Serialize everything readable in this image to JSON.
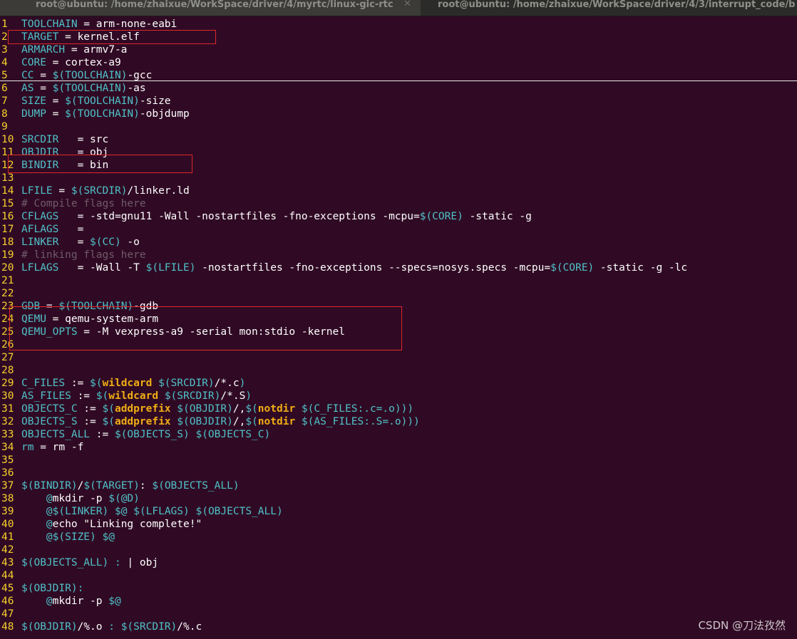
{
  "tabs": [
    {
      "title": "root@ubuntu: /home/zhaixue/WorkSpace/driver/4/myrtc/linux-gic-rtc",
      "close": "✕"
    },
    {
      "title": "root@ubuntu: /home/zhaixue/WorkSpace/driver/4/3/interrupt_code/b"
    }
  ],
  "watermark": "CSDN @刀法孜然",
  "lines": [
    {
      "n": "1",
      "segs": [
        [
          "v",
          "TOOLCHAIN"
        ],
        [
          "t",
          " = arm-none-eabi"
        ]
      ]
    },
    {
      "n": "2",
      "segs": [
        [
          "v",
          "TARGET"
        ],
        [
          "t",
          " = kernel.elf"
        ]
      ]
    },
    {
      "n": "3",
      "segs": [
        [
          "v",
          "ARMARCH"
        ],
        [
          "t",
          " = armv7-a"
        ]
      ]
    },
    {
      "n": "4",
      "segs": [
        [
          "v",
          "CORE"
        ],
        [
          "t",
          " = cortex-a9"
        ]
      ]
    },
    {
      "n": "5",
      "segs": [
        [
          "v",
          "CC"
        ],
        [
          "t",
          " = "
        ],
        [
          "v",
          "$(TOOLCHAIN)"
        ],
        [
          "t",
          "-gcc"
        ]
      ]
    },
    {
      "n": "6",
      "segs": [
        [
          "v",
          "AS"
        ],
        [
          "t",
          " = "
        ],
        [
          "v",
          "$(TOOLCHAIN)"
        ],
        [
          "t",
          "-as"
        ]
      ]
    },
    {
      "n": "7",
      "segs": [
        [
          "v",
          "SIZE"
        ],
        [
          "t",
          " = "
        ],
        [
          "v",
          "$(TOOLCHAIN)"
        ],
        [
          "t",
          "-size"
        ]
      ]
    },
    {
      "n": "8",
      "segs": [
        [
          "v",
          "DUMP"
        ],
        [
          "t",
          " = "
        ],
        [
          "v",
          "$(TOOLCHAIN)"
        ],
        [
          "t",
          "-objdump"
        ]
      ]
    },
    {
      "n": "9",
      "segs": []
    },
    {
      "n": "10",
      "segs": [
        [
          "v",
          "SRCDIR"
        ],
        [
          "t",
          "   = src"
        ]
      ]
    },
    {
      "n": "11",
      "segs": [
        [
          "v",
          "OBJDIR"
        ],
        [
          "t",
          "   = obj"
        ]
      ]
    },
    {
      "n": "12",
      "segs": [
        [
          "v",
          "BINDIR"
        ],
        [
          "t",
          "   = bin"
        ]
      ]
    },
    {
      "n": "13",
      "segs": []
    },
    {
      "n": "14",
      "segs": [
        [
          "v",
          "LFILE"
        ],
        [
          "t",
          " = "
        ],
        [
          "v",
          "$(SRCDIR)"
        ],
        [
          "t",
          "/linker.ld"
        ]
      ]
    },
    {
      "n": "15",
      "segs": [
        [
          "c",
          "# Compile flags here"
        ]
      ]
    },
    {
      "n": "16",
      "segs": [
        [
          "v",
          "CFLAGS"
        ],
        [
          "t",
          "   = -std=gnu11 -Wall -nostartfiles -fno-exceptions -mcpu="
        ],
        [
          "v",
          "$(CORE)"
        ],
        [
          "t",
          " -static -g"
        ]
      ]
    },
    {
      "n": "17",
      "segs": [
        [
          "v",
          "AFLAGS"
        ],
        [
          "t",
          "   ="
        ]
      ]
    },
    {
      "n": "18",
      "segs": [
        [
          "v",
          "LINKER"
        ],
        [
          "t",
          "   = "
        ],
        [
          "v",
          "$(CC)"
        ],
        [
          "t",
          " -o"
        ]
      ]
    },
    {
      "n": "19",
      "segs": [
        [
          "c",
          "# linking flags here"
        ]
      ]
    },
    {
      "n": "20",
      "segs": [
        [
          "v",
          "LFLAGS"
        ],
        [
          "t",
          "   = -Wall -T "
        ],
        [
          "v",
          "$(LFILE)"
        ],
        [
          "t",
          " -nostartfiles -fno-exceptions --specs=nosys.specs -mcpu="
        ],
        [
          "v",
          "$(CORE)"
        ],
        [
          "t",
          " -static -g -lc"
        ]
      ]
    },
    {
      "n": "21",
      "segs": []
    },
    {
      "n": "22",
      "segs": []
    },
    {
      "n": "23",
      "segs": [
        [
          "v",
          "GDB"
        ],
        [
          "t",
          " = "
        ],
        [
          "v",
          "$(TOOLCHAIN)"
        ],
        [
          "t",
          "-gdb"
        ]
      ]
    },
    {
      "n": "24",
      "segs": [
        [
          "v",
          "QEMU"
        ],
        [
          "t",
          " = qemu-system-arm"
        ]
      ]
    },
    {
      "n": "25",
      "segs": [
        [
          "v",
          "QEMU_OPTS"
        ],
        [
          "t",
          " = -M vexpress-a9 -serial mon:stdio -kernel"
        ]
      ]
    },
    {
      "n": "26",
      "segs": []
    },
    {
      "n": "27",
      "segs": []
    },
    {
      "n": "28",
      "segs": []
    },
    {
      "n": "29",
      "segs": [
        [
          "v",
          "C_FILES"
        ],
        [
          "t",
          " := "
        ],
        [
          "v",
          "$("
        ],
        [
          "k",
          "wildcard"
        ],
        [
          "t",
          " "
        ],
        [
          "v",
          "$(SRCDIR)"
        ],
        [
          "t",
          "/*.c"
        ],
        [
          "v",
          ")"
        ]
      ]
    },
    {
      "n": "30",
      "segs": [
        [
          "v",
          "AS_FILES"
        ],
        [
          "t",
          " := "
        ],
        [
          "v",
          "$("
        ],
        [
          "k",
          "wildcard"
        ],
        [
          "t",
          " "
        ],
        [
          "v",
          "$(SRCDIR)"
        ],
        [
          "t",
          "/*.S"
        ],
        [
          "v",
          ")"
        ]
      ]
    },
    {
      "n": "31",
      "segs": [
        [
          "v",
          "OBJECTS_C"
        ],
        [
          "t",
          " := "
        ],
        [
          "v",
          "$("
        ],
        [
          "k",
          "addprefix"
        ],
        [
          "t",
          " "
        ],
        [
          "v",
          "$(OBJDIR)"
        ],
        [
          "t",
          "/,"
        ],
        [
          "v",
          "$("
        ],
        [
          "k",
          "notdir"
        ],
        [
          "t",
          " "
        ],
        [
          "v",
          "$(C_FILES:.c=.o)))"
        ]
      ]
    },
    {
      "n": "32",
      "segs": [
        [
          "v",
          "OBJECTS_S"
        ],
        [
          "t",
          " := "
        ],
        [
          "v",
          "$("
        ],
        [
          "k",
          "addprefix"
        ],
        [
          "t",
          " "
        ],
        [
          "v",
          "$(OBJDIR)"
        ],
        [
          "t",
          "/,"
        ],
        [
          "v",
          "$("
        ],
        [
          "k",
          "notdir"
        ],
        [
          "t",
          " "
        ],
        [
          "v",
          "$(AS_FILES:.S=.o)))"
        ]
      ]
    },
    {
      "n": "33",
      "segs": [
        [
          "v",
          "OBJECTS_ALL"
        ],
        [
          "t",
          " := "
        ],
        [
          "v",
          "$(OBJECTS_S)"
        ],
        [
          "t",
          " "
        ],
        [
          "v",
          "$(OBJECTS_C)"
        ]
      ]
    },
    {
      "n": "34",
      "segs": [
        [
          "v",
          "rm"
        ],
        [
          "t",
          " = rm -f"
        ]
      ]
    },
    {
      "n": "35",
      "segs": []
    },
    {
      "n": "36",
      "segs": []
    },
    {
      "n": "37",
      "segs": [
        [
          "v",
          "$(BINDIR)"
        ],
        [
          "t",
          "/"
        ],
        [
          "v",
          "$(TARGET)"
        ],
        [
          "t",
          ": "
        ],
        [
          "v",
          "$(OBJECTS_ALL)"
        ]
      ]
    },
    {
      "n": "38",
      "segs": [
        [
          "t",
          "    "
        ],
        [
          "v",
          "@"
        ],
        [
          "t",
          "mkdir -p "
        ],
        [
          "v",
          "$(@D)"
        ]
      ]
    },
    {
      "n": "39",
      "segs": [
        [
          "t",
          "    "
        ],
        [
          "v",
          "@$(LINKER)"
        ],
        [
          "t",
          " "
        ],
        [
          "v",
          "$@"
        ],
        [
          "t",
          " "
        ],
        [
          "v",
          "$(LFLAGS)"
        ],
        [
          "t",
          " "
        ],
        [
          "v",
          "$(OBJECTS_ALL)"
        ]
      ]
    },
    {
      "n": "40",
      "segs": [
        [
          "t",
          "    "
        ],
        [
          "v",
          "@"
        ],
        [
          "t",
          "echo \"Linking complete!\""
        ]
      ]
    },
    {
      "n": "41",
      "segs": [
        [
          "t",
          "    "
        ],
        [
          "v",
          "@$(SIZE)"
        ],
        [
          "t",
          " "
        ],
        [
          "v",
          "$@"
        ]
      ]
    },
    {
      "n": "42",
      "segs": []
    },
    {
      "n": "43",
      "segs": [
        [
          "v",
          "$(OBJECTS_ALL)"
        ],
        [
          "t",
          " "
        ],
        [
          "v",
          ":"
        ],
        [
          "t",
          " | obj"
        ]
      ]
    },
    {
      "n": "44",
      "segs": []
    },
    {
      "n": "45",
      "segs": [
        [
          "v",
          "$(OBJDIR):"
        ]
      ]
    },
    {
      "n": "46",
      "segs": [
        [
          "t",
          "    "
        ],
        [
          "v",
          "@"
        ],
        [
          "t",
          "mkdir -p "
        ],
        [
          "v",
          "$@"
        ]
      ]
    },
    {
      "n": "47",
      "segs": []
    },
    {
      "n": "48",
      "segs": [
        [
          "v",
          "$(OBJDIR)"
        ],
        [
          "t",
          "/%.o "
        ],
        [
          "v",
          ":"
        ],
        [
          "t",
          " "
        ],
        [
          "v",
          "$(SRCDIR)"
        ],
        [
          "t",
          "/%.c"
        ]
      ]
    }
  ]
}
